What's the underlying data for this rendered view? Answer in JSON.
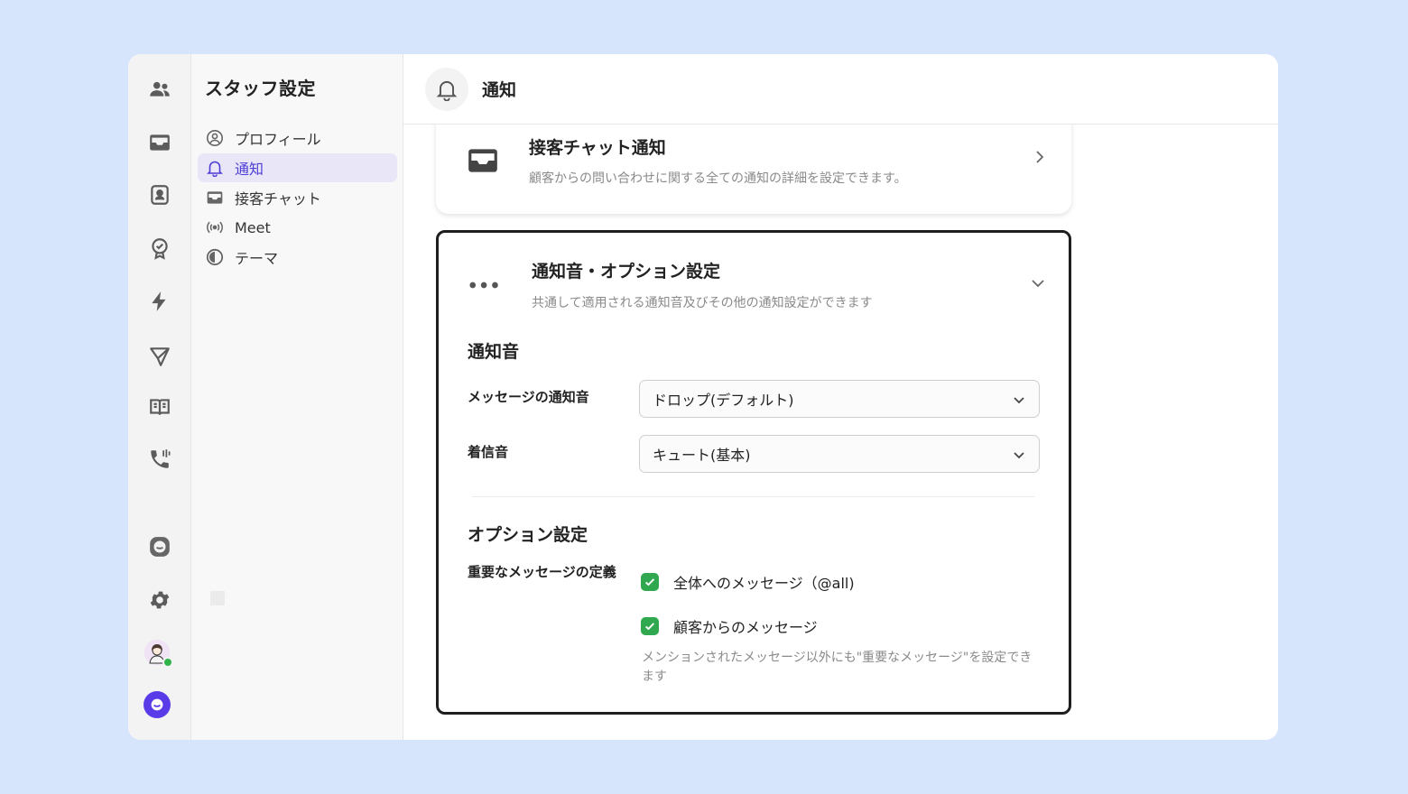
{
  "sidebar_title": "スタッフ設定",
  "nav": {
    "items": [
      {
        "label": "プロフィール",
        "icon": "user-circle-icon"
      },
      {
        "label": "通知",
        "icon": "bell-icon",
        "active": true
      },
      {
        "label": "接客チャット",
        "icon": "inbox-icon"
      },
      {
        "label": "Meet",
        "icon": "broadcast-icon"
      },
      {
        "label": "テーマ",
        "icon": "half-circle-icon"
      }
    ]
  },
  "rail": {
    "icons": [
      "users-icon",
      "inbox-icon",
      "contact-card-icon",
      "badge-check-icon",
      "bolt-icon",
      "send-icon",
      "book-icon",
      "phone-icon",
      "chat-bubble-icon",
      "gear-icon",
      "avatar",
      "brand-icon"
    ],
    "status_color": "#2fb34a",
    "brand_color": "#5a3be8"
  },
  "header": {
    "title": "通知",
    "icon": "bell-icon"
  },
  "chat_card": {
    "title": "接客チャット通知",
    "subtitle": "顧客からの問い合わせに関する全ての通知の詳細を設定できます。",
    "icon": "inbox-icon"
  },
  "options_card": {
    "title": "通知音・オプション設定",
    "subtitle": "共通して適用される通知音及びその他の通知設定ができます",
    "icon": "more-dots-icon",
    "sound_section": {
      "title": "通知音",
      "message_sound_label": "メッセージの通知音",
      "message_sound_value": "ドロップ(デフォルト)",
      "ringtone_label": "着信音",
      "ringtone_value": "キュート(基本)"
    },
    "option_section": {
      "title": "オプション設定",
      "important_label": "重要なメッセージの定義",
      "checkboxes": [
        {
          "label": "全体へのメッセージ（@all)",
          "checked": true
        },
        {
          "label": "顧客からのメッセージ",
          "checked": true
        }
      ],
      "hint": "メンションされたメッセージ以外にも\"重要なメッセージ\"を設定できます",
      "check_color": "#2fa84f"
    }
  }
}
